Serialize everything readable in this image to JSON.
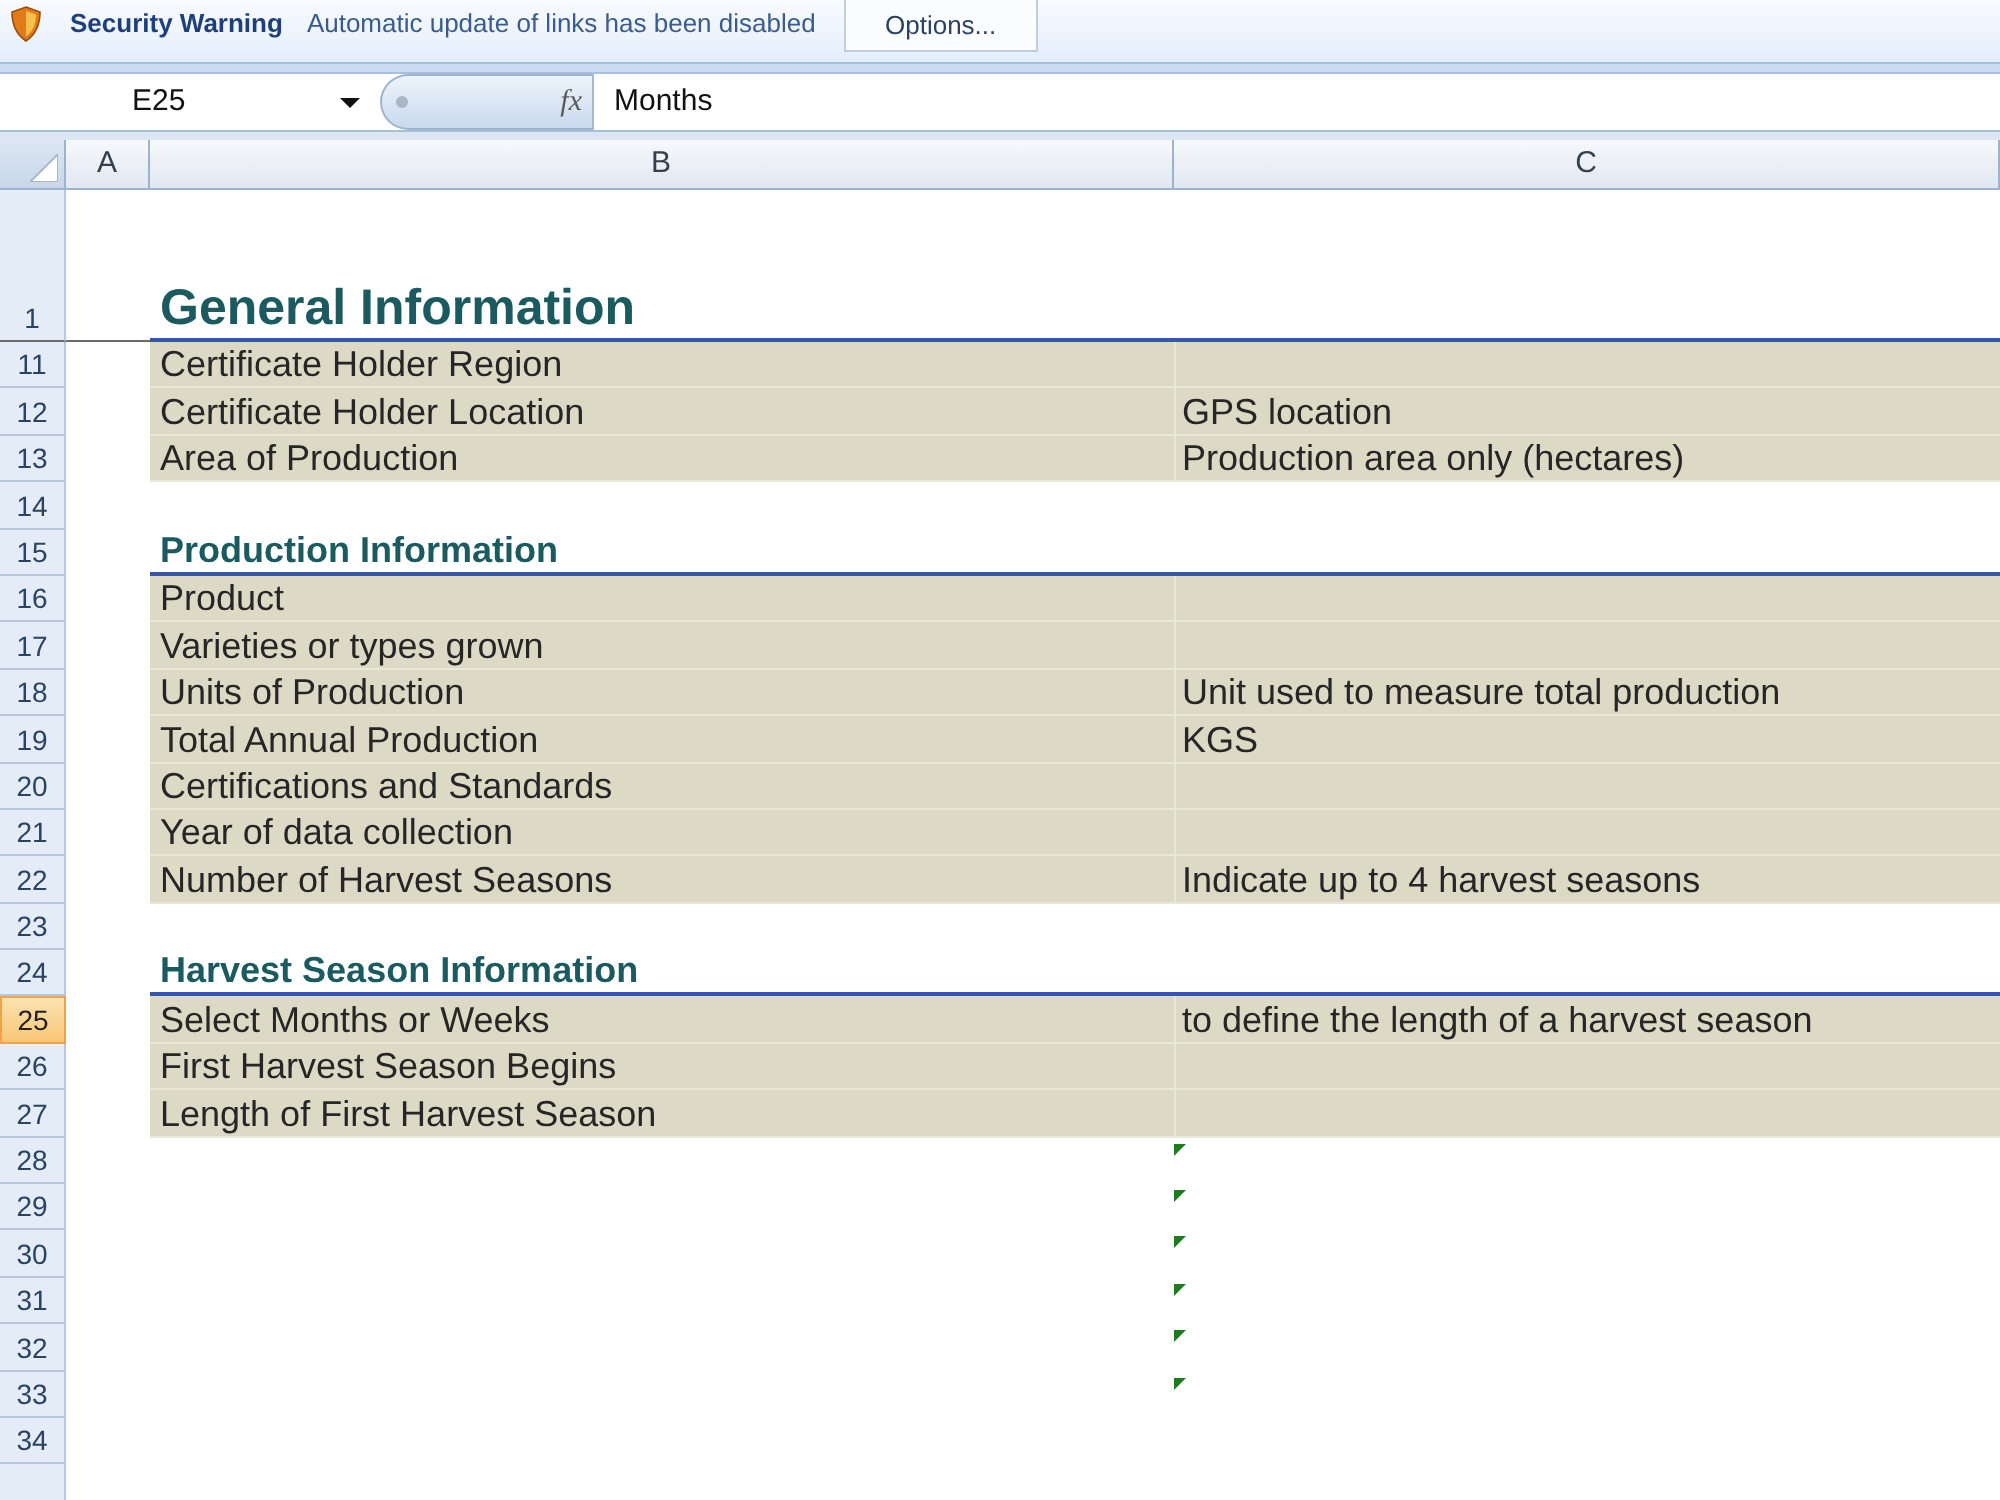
{
  "security_bar": {
    "title": "Security Warning",
    "message": "Automatic update of links has been disabled",
    "button": "Options..."
  },
  "formula_bar": {
    "name_box": "E25",
    "function_button": "fx",
    "formula": "Months"
  },
  "columns": [
    "A",
    "B",
    "C"
  ],
  "rows": [
    {
      "number": "1",
      "selected": false,
      "kind": "title",
      "label": "General Information",
      "indicator": false
    },
    {
      "number": "11",
      "selected": false,
      "kind": "field",
      "label": "Certificate Holder Region",
      "indicator": false
    },
    {
      "number": "12",
      "selected": false,
      "kind": "field",
      "label": "Certificate Holder Location",
      "note": "GPS location",
      "indicator": false
    },
    {
      "number": "13",
      "selected": false,
      "kind": "field",
      "label": "Area of Production",
      "note": "Production area only (hectares)",
      "indicator": false
    },
    {
      "number": "14",
      "selected": false,
      "kind": "blank",
      "indicator": false
    },
    {
      "number": "15",
      "selected": false,
      "kind": "heading",
      "label": "Production Information",
      "indicator": false
    },
    {
      "number": "16",
      "selected": false,
      "kind": "field",
      "label": "Product",
      "indicator": false
    },
    {
      "number": "17",
      "selected": false,
      "kind": "field",
      "label": "Varieties or types grown",
      "indicator": false
    },
    {
      "number": "18",
      "selected": false,
      "kind": "field",
      "label": "Units of Production",
      "note": "Unit used to measure total production",
      "indicator": false
    },
    {
      "number": "19",
      "selected": false,
      "kind": "field",
      "label": "Total Annual Production",
      "note": "KGS",
      "indicator": false
    },
    {
      "number": "20",
      "selected": false,
      "kind": "field",
      "label": "Certifications and Standards",
      "indicator": false
    },
    {
      "number": "21",
      "selected": false,
      "kind": "field",
      "label": "Year of data collection",
      "indicator": false
    },
    {
      "number": "22",
      "selected": false,
      "kind": "field",
      "label": "Number of Harvest Seasons",
      "note": "Indicate up to 4 harvest seasons",
      "indicator": false
    },
    {
      "number": "23",
      "selected": false,
      "kind": "blank",
      "indicator": false
    },
    {
      "number": "24",
      "selected": false,
      "kind": "heading",
      "label": "Harvest Season Information",
      "indicator": false
    },
    {
      "number": "25",
      "selected": true,
      "kind": "field",
      "label": "Select Months or Weeks",
      "note": "to define the length of a harvest season",
      "indicator": false
    },
    {
      "number": "26",
      "selected": false,
      "kind": "field",
      "label": "First Harvest Season Begins",
      "indicator": false
    },
    {
      "number": "27",
      "selected": false,
      "kind": "field",
      "label": "Length of First Harvest Season",
      "indicator": false
    },
    {
      "number": "28",
      "selected": false,
      "kind": "blank",
      "indicator": true
    },
    {
      "number": "29",
      "selected": false,
      "kind": "blank",
      "indicator": true
    },
    {
      "number": "30",
      "selected": false,
      "kind": "blank",
      "indicator": true
    },
    {
      "number": "31",
      "selected": false,
      "kind": "blank",
      "indicator": true
    },
    {
      "number": "32",
      "selected": false,
      "kind": "blank",
      "indicator": true
    },
    {
      "number": "33",
      "selected": false,
      "kind": "blank",
      "indicator": true
    },
    {
      "number": "34",
      "selected": false,
      "kind": "blank",
      "indicator": false
    }
  ]
}
